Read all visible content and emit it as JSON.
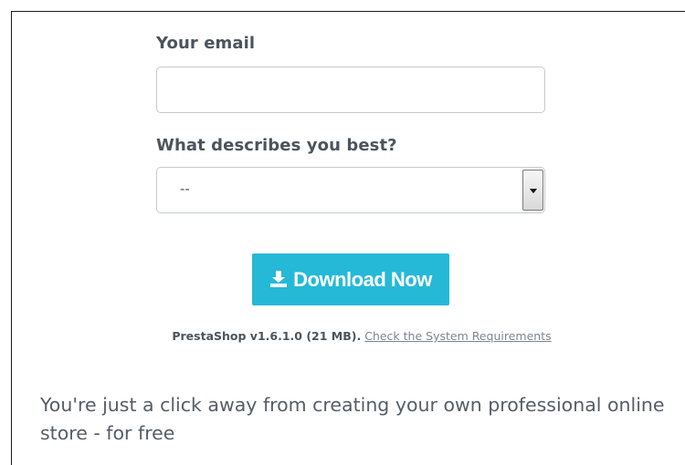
{
  "form": {
    "email_label": "Your email",
    "email_value": "",
    "email_placeholder": "",
    "describe_label": "What describes you best?",
    "describe_selected": "--"
  },
  "download": {
    "button_label": "Download Now",
    "icon": "download-icon",
    "version_text": "PrestaShop v1.6.1.0 (21 MB).",
    "requirements_link": "Check the System Requirements"
  },
  "tagline": "You're just a click away from creating your own professional online store - for free",
  "colors": {
    "button_bg": "#25b9d7",
    "label_text": "#4b545c",
    "link_text": "#7b8591",
    "border": "#c7c9cc"
  }
}
